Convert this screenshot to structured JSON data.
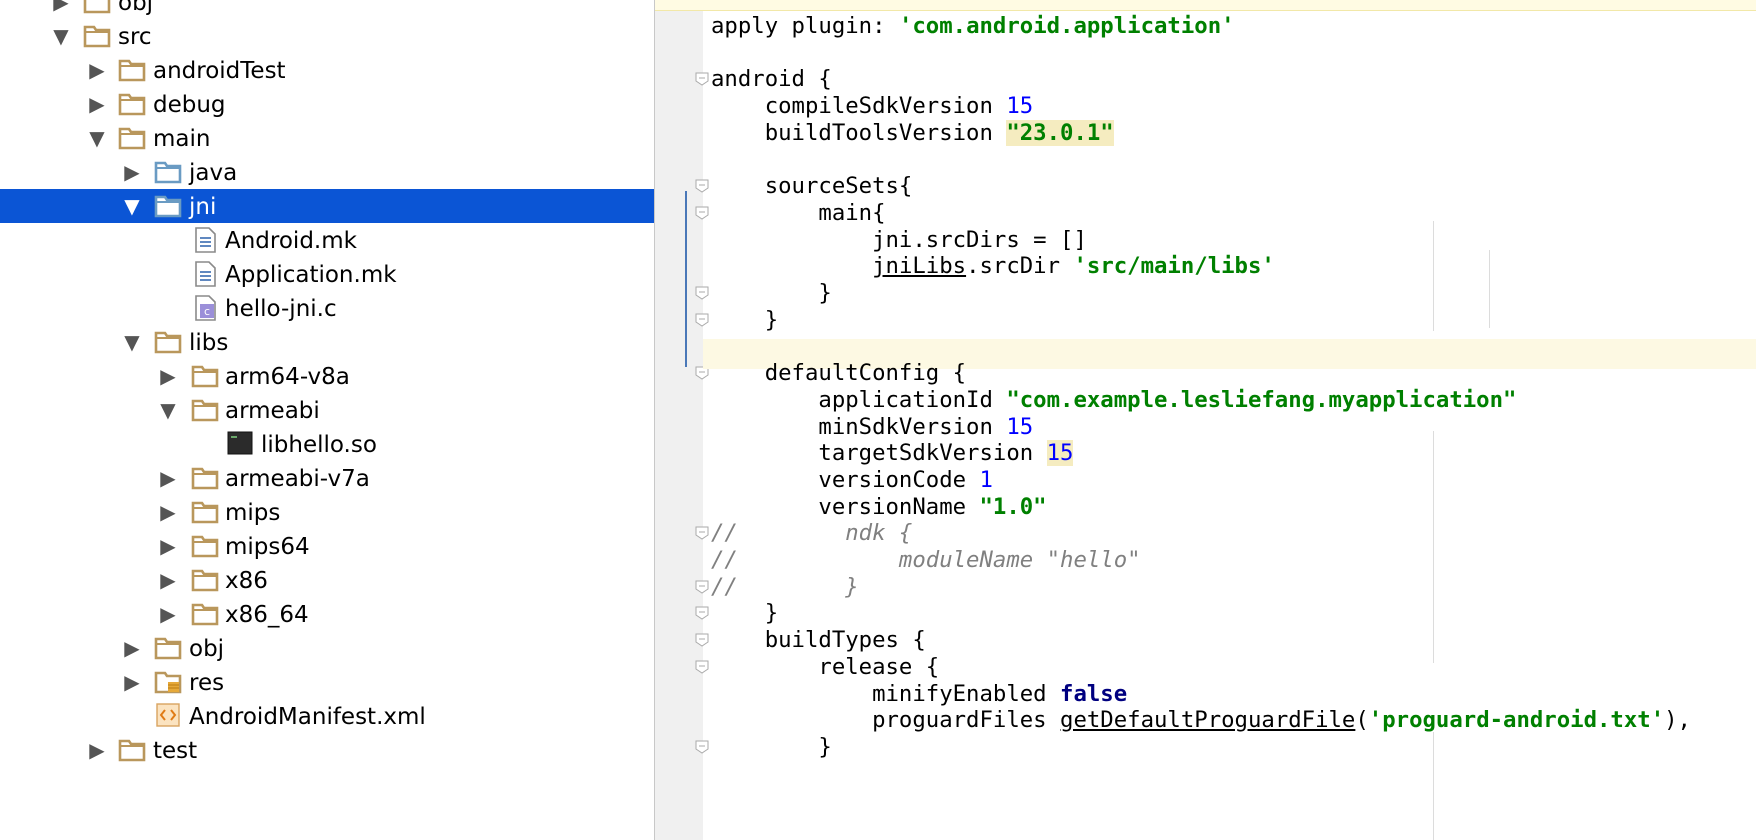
{
  "project_tree": {
    "rows": [
      {
        "label": "obj",
        "depth": 1,
        "arrow": "right",
        "icon": "folder-icon"
      },
      {
        "label": "src",
        "depth": 1,
        "arrow": "down",
        "icon": "folder-icon"
      },
      {
        "label": "androidTest",
        "depth": 2,
        "arrow": "right",
        "icon": "folder-icon"
      },
      {
        "label": "debug",
        "depth": 2,
        "arrow": "right",
        "icon": "folder-icon"
      },
      {
        "label": "main",
        "depth": 2,
        "arrow": "down",
        "icon": "folder-icon"
      },
      {
        "label": "java",
        "depth": 3,
        "arrow": "right",
        "icon": "source-folder-icon"
      },
      {
        "label": "jni",
        "depth": 3,
        "arrow": "down",
        "icon": "source-folder-icon",
        "selected": true
      },
      {
        "label": "Android.mk",
        "depth": 4,
        "arrow": "",
        "icon": "text-file-icon"
      },
      {
        "label": "Application.mk",
        "depth": 4,
        "arrow": "",
        "icon": "text-file-icon"
      },
      {
        "label": "hello-jni.c",
        "depth": 4,
        "arrow": "",
        "icon": "c-file-icon"
      },
      {
        "label": "libs",
        "depth": 3,
        "arrow": "down",
        "icon": "folder-icon"
      },
      {
        "label": "arm64-v8a",
        "depth": 4,
        "arrow": "right",
        "icon": "folder-icon"
      },
      {
        "label": "armeabi",
        "depth": 4,
        "arrow": "down",
        "icon": "folder-icon"
      },
      {
        "label": "libhello.so",
        "depth": 5,
        "arrow": "",
        "icon": "binary-file-icon"
      },
      {
        "label": "armeabi-v7a",
        "depth": 4,
        "arrow": "right",
        "icon": "folder-icon"
      },
      {
        "label": "mips",
        "depth": 4,
        "arrow": "right",
        "icon": "folder-icon"
      },
      {
        "label": "mips64",
        "depth": 4,
        "arrow": "right",
        "icon": "folder-icon"
      },
      {
        "label": "x86",
        "depth": 4,
        "arrow": "right",
        "icon": "folder-icon"
      },
      {
        "label": "x86_64",
        "depth": 4,
        "arrow": "right",
        "icon": "folder-icon"
      },
      {
        "label": "obj",
        "depth": 3,
        "arrow": "right",
        "icon": "folder-icon"
      },
      {
        "label": "res",
        "depth": 3,
        "arrow": "right",
        "icon": "resource-folder-icon"
      },
      {
        "label": "AndroidManifest.xml",
        "depth": 3,
        "arrow": "",
        "icon": "xml-file-icon"
      },
      {
        "label": "test",
        "depth": 2,
        "arrow": "right",
        "icon": "folder-icon"
      }
    ]
  },
  "editor": {
    "lines": [
      [
        [
          "apply ",
          ""
        ],
        [
          "plugin",
          ""
        ],
        [
          ": ",
          ""
        ],
        [
          "'com.android.application'",
          "str"
        ]
      ],
      [],
      [
        [
          "android {",
          ""
        ]
      ],
      [
        [
          "    compileSdkVersion ",
          ""
        ],
        [
          "15",
          "num"
        ]
      ],
      [
        [
          "    buildToolsVersion ",
          ""
        ],
        [
          "\"23.0.1\"",
          "str hl"
        ]
      ],
      [],
      [
        [
          "    sourceSets{",
          ""
        ]
      ],
      [
        [
          "        main{",
          ""
        ]
      ],
      [
        [
          "            jni.srcDirs = []",
          ""
        ]
      ],
      [
        [
          "            ",
          ""
        ],
        [
          "jniLibs",
          "und"
        ],
        [
          ".srcDir ",
          ""
        ],
        [
          "'src/main/libs'",
          "str"
        ]
      ],
      [
        [
          "        }",
          ""
        ]
      ],
      [
        [
          "    }",
          ""
        ]
      ],
      [],
      [
        [
          "    defaultConfig {",
          ""
        ]
      ],
      [
        [
          "        applicationId ",
          ""
        ],
        [
          "\"com.example.lesliefang.myapplication\"",
          "str"
        ]
      ],
      [
        [
          "        minSdkVersion ",
          ""
        ],
        [
          "15",
          "num"
        ]
      ],
      [
        [
          "        targetSdkVersion ",
          ""
        ],
        [
          "15",
          "num hl"
        ]
      ],
      [
        [
          "        versionCode ",
          ""
        ],
        [
          "1",
          "num"
        ]
      ],
      [
        [
          "        versionName ",
          ""
        ],
        [
          "\"1.0\"",
          "str"
        ]
      ],
      [
        [
          "//        ndk {",
          "cmt"
        ]
      ],
      [
        [
          "//            moduleName \"hello\"",
          "cmt"
        ]
      ],
      [
        [
          "//        }",
          "cmt"
        ]
      ],
      [
        [
          "    }",
          ""
        ]
      ],
      [
        [
          "    buildTypes {",
          ""
        ]
      ],
      [
        [
          "        release {",
          ""
        ]
      ],
      [
        [
          "            minifyEnabled ",
          ""
        ],
        [
          "false",
          "kw"
        ]
      ],
      [
        [
          "            proguardFiles ",
          ""
        ],
        [
          "getDefaultProguardFile",
          "und"
        ],
        [
          "(",
          ""
        ],
        [
          "'proguard-android.txt'",
          "str"
        ],
        [
          "),",
          ""
        ]
      ],
      [
        [
          "        }",
          ""
        ]
      ]
    ]
  },
  "colors": {
    "selection": "#0b55d5",
    "folder": "#b9975c",
    "source_folder": "#6a9bc3",
    "string": "#008000",
    "number": "#0000ff",
    "keyword": "#000080"
  }
}
